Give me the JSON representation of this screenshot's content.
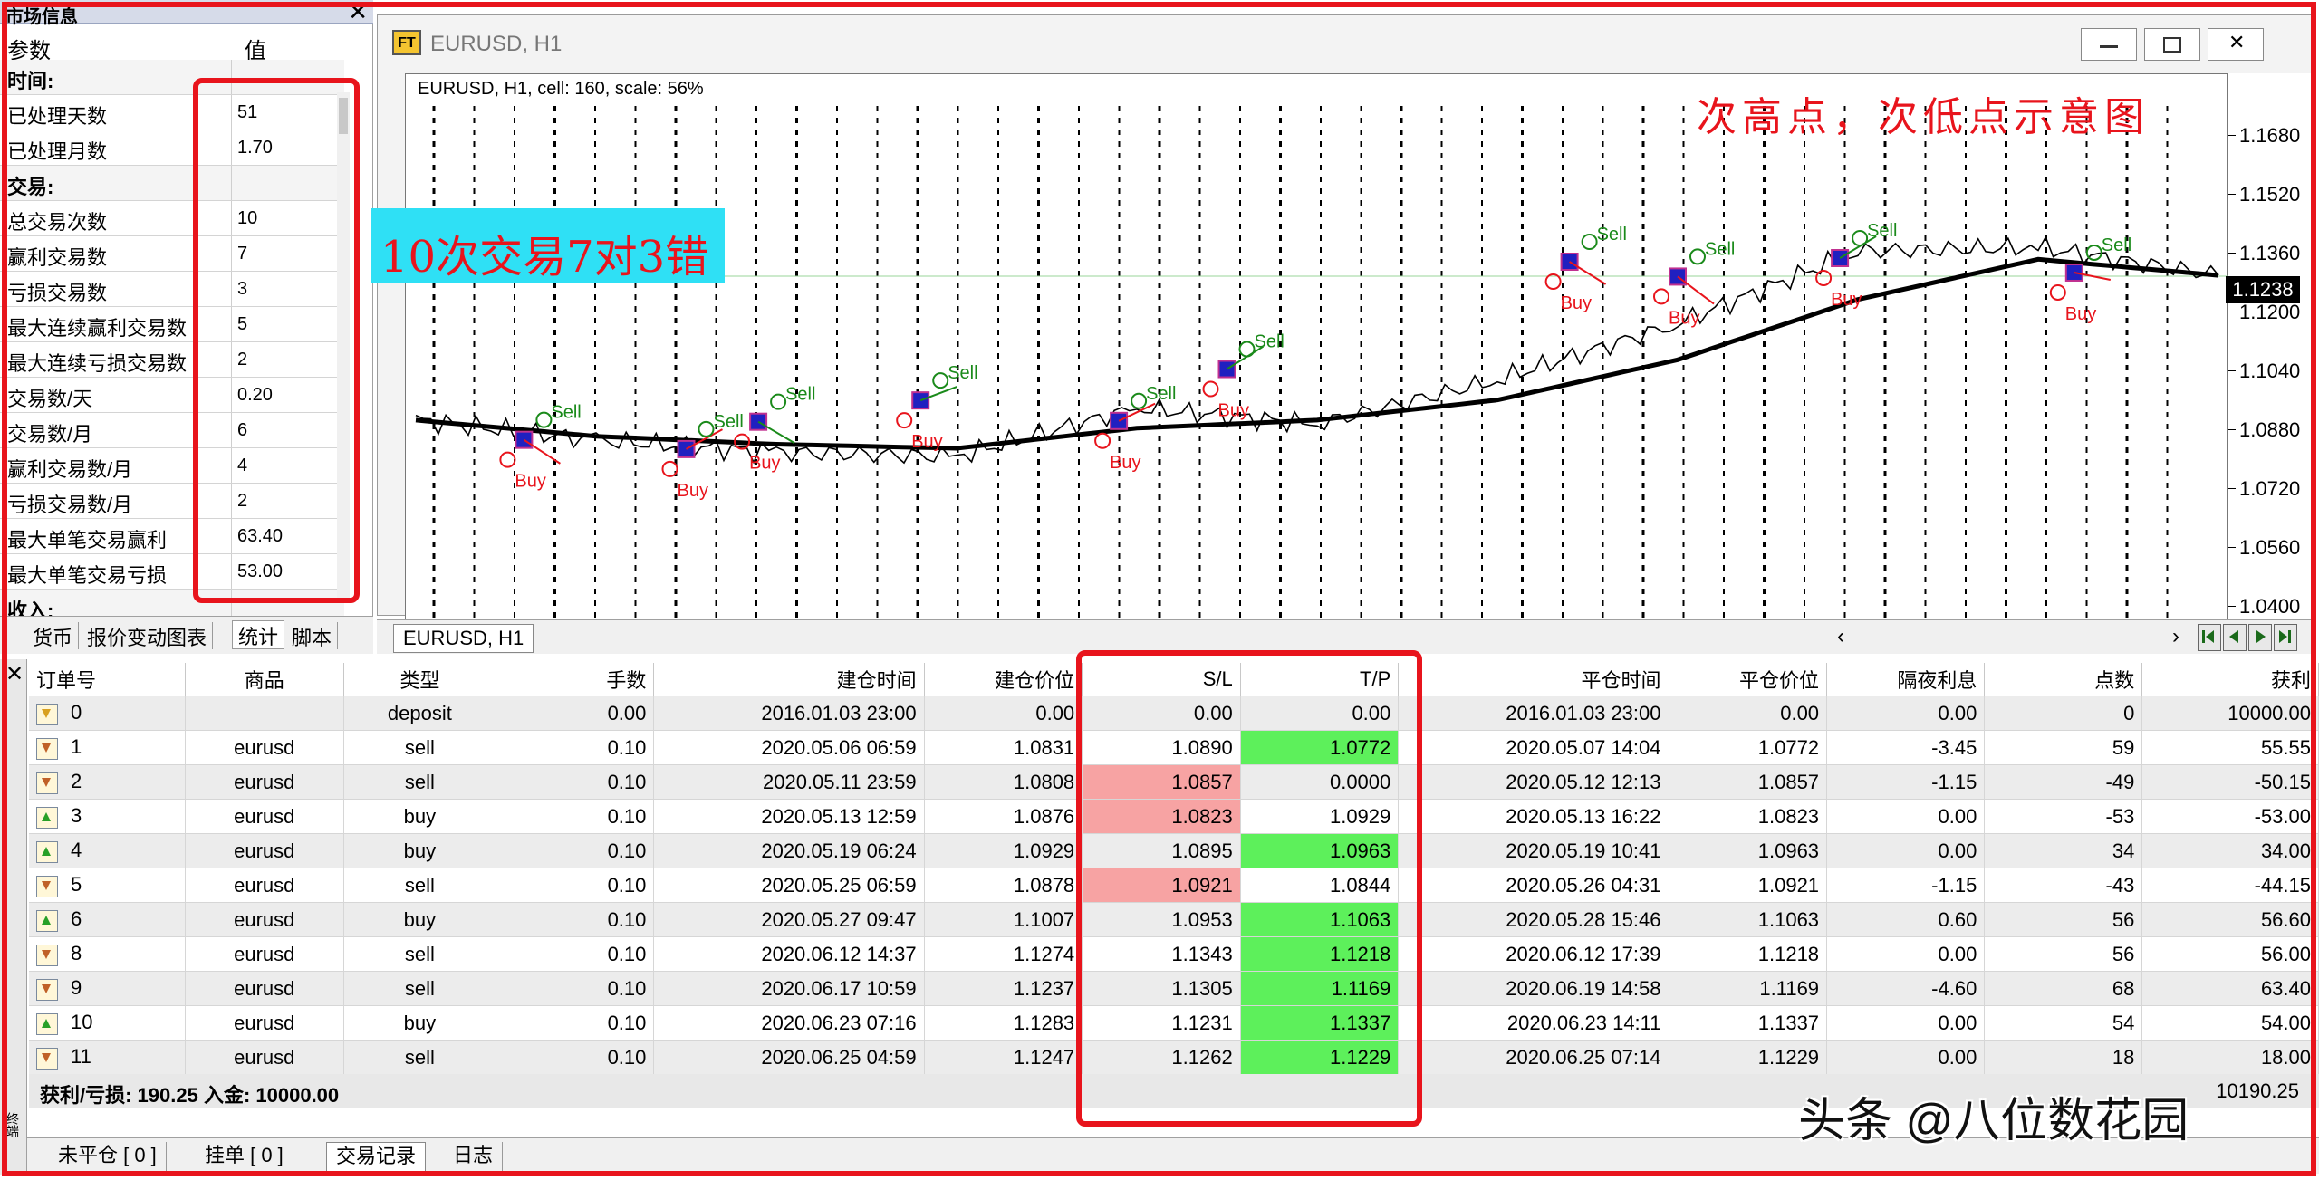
{
  "left_panel": {
    "title": "市场信息",
    "col_param": "参数",
    "col_value": "值",
    "rows": [
      {
        "k": "时间:",
        "v": "",
        "section": true
      },
      {
        "k": "已处理天数",
        "v": "51"
      },
      {
        "k": "已处理月数",
        "v": "1.70"
      },
      {
        "k": "交易:",
        "v": "",
        "section": true
      },
      {
        "k": "总交易次数",
        "v": "10"
      },
      {
        "k": "赢利交易数",
        "v": "7"
      },
      {
        "k": "亏损交易数",
        "v": "3"
      },
      {
        "k": "最大连续赢利交易数",
        "v": "5"
      },
      {
        "k": "最大连续亏损交易数",
        "v": "2"
      },
      {
        "k": "交易数/天",
        "v": "0.20"
      },
      {
        "k": "交易数/月",
        "v": "6"
      },
      {
        "k": "赢利交易数/月",
        "v": "4"
      },
      {
        "k": "亏损交易数/月",
        "v": "2"
      },
      {
        "k": "最大单笔交易赢利",
        "v": "63.40"
      },
      {
        "k": "最大单笔交易亏损",
        "v": "53.00"
      },
      {
        "k": "收入:",
        "v": "",
        "section": true
      }
    ],
    "tabs": [
      "货币",
      "报价变动图表",
      "统计",
      "脚本"
    ],
    "active_tab": 2
  },
  "annotation": "10次交易7对3错",
  "chart": {
    "window_title": "EURUSD, H1",
    "app_icon": "FT",
    "info": "EURUSD, H1, cell: 160, scale: 56%",
    "note": "次高点，次低点示意图",
    "price_ticks": [
      "1.1680",
      "1.1520",
      "1.1360",
      "1.1200",
      "1.1040",
      "1.0880",
      "1.0720",
      "1.0560",
      "1.0400"
    ],
    "current_price": "1.1238",
    "tab_label": "EURUSD, H1",
    "signal_buy": "Buy",
    "signal_sell": "Sell"
  },
  "chart_data": {
    "type": "line",
    "title": "",
    "xlabel": "",
    "ylabel": "",
    "ylim": [
      1.04,
      1.172
    ],
    "series": [
      {
        "name": "",
        "x": [
          0,
          10,
          20,
          30,
          40,
          50,
          60,
          70,
          80,
          90,
          100
        ],
        "values": [
          1.088,
          1.083,
          1.08,
          1.079,
          1.091,
          1.087,
          1.098,
          1.112,
          1.13,
          1.131,
          1.124
        ]
      },
      {
        "name": "",
        "x": [
          0,
          10,
          20,
          30,
          40,
          50,
          60,
          70,
          80,
          90,
          100
        ],
        "values": [
          1.088,
          1.084,
          1.082,
          1.081,
          1.086,
          1.088,
          1.093,
          1.103,
          1.118,
          1.128,
          1.124
        ]
      }
    ]
  },
  "trades": {
    "headers": [
      "订单号",
      "商品",
      "类型",
      "手数",
      "建仓时间",
      "建仓价位",
      "S/L",
      "T/P",
      "平仓时间",
      "平仓价位",
      "隔夜利息",
      "点数",
      "获利"
    ],
    "rows": [
      {
        "id": "0",
        "sym": "",
        "type": "deposit",
        "lots": "0.00",
        "open_time": "2016.01.03 23:00",
        "open_price": "0.00",
        "sl": "0.00",
        "tp": "0.00",
        "close_time": "2016.01.03 23:00",
        "close_price": "0.00",
        "swap": "0.00",
        "pips": "0",
        "profit": "10000.00",
        "icon": "dep",
        "sl_hl": "",
        "tp_hl": ""
      },
      {
        "id": "1",
        "sym": "eurusd",
        "type": "sell",
        "lots": "0.10",
        "open_time": "2020.05.06 06:59",
        "open_price": "1.0831",
        "sl": "1.0890",
        "tp": "1.0772",
        "close_time": "2020.05.07 14:04",
        "close_price": "1.0772",
        "swap": "-3.45",
        "pips": "59",
        "profit": "55.55",
        "icon": "sell",
        "sl_hl": "",
        "tp_hl": "green"
      },
      {
        "id": "2",
        "sym": "eurusd",
        "type": "sell",
        "lots": "0.10",
        "open_time": "2020.05.11 23:59",
        "open_price": "1.0808",
        "sl": "1.0857",
        "tp": "0.0000",
        "close_time": "2020.05.12 12:13",
        "close_price": "1.0857",
        "swap": "-1.15",
        "pips": "-49",
        "profit": "-50.15",
        "icon": "sell",
        "sl_hl": "pink",
        "tp_hl": ""
      },
      {
        "id": "3",
        "sym": "eurusd",
        "type": "buy",
        "lots": "0.10",
        "open_time": "2020.05.13 12:59",
        "open_price": "1.0876",
        "sl": "1.0823",
        "tp": "1.0929",
        "close_time": "2020.05.13 16:22",
        "close_price": "1.0823",
        "swap": "0.00",
        "pips": "-53",
        "profit": "-53.00",
        "icon": "buy",
        "sl_hl": "pink",
        "tp_hl": ""
      },
      {
        "id": "4",
        "sym": "eurusd",
        "type": "buy",
        "lots": "0.10",
        "open_time": "2020.05.19 06:24",
        "open_price": "1.0929",
        "sl": "1.0895",
        "tp": "1.0963",
        "close_time": "2020.05.19 10:41",
        "close_price": "1.0963",
        "swap": "0.00",
        "pips": "34",
        "profit": "34.00",
        "icon": "buy",
        "sl_hl": "",
        "tp_hl": "green"
      },
      {
        "id": "5",
        "sym": "eurusd",
        "type": "sell",
        "lots": "0.10",
        "open_time": "2020.05.25 06:59",
        "open_price": "1.0878",
        "sl": "1.0921",
        "tp": "1.0844",
        "close_time": "2020.05.26 04:31",
        "close_price": "1.0921",
        "swap": "-1.15",
        "pips": "-43",
        "profit": "-44.15",
        "icon": "sell",
        "sl_hl": "pink",
        "tp_hl": ""
      },
      {
        "id": "6",
        "sym": "eurusd",
        "type": "buy",
        "lots": "0.10",
        "open_time": "2020.05.27 09:47",
        "open_price": "1.1007",
        "sl": "1.0953",
        "tp": "1.1063",
        "close_time": "2020.05.28 15:46",
        "close_price": "1.1063",
        "swap": "0.60",
        "pips": "56",
        "profit": "56.60",
        "icon": "buy",
        "sl_hl": "",
        "tp_hl": "green"
      },
      {
        "id": "8",
        "sym": "eurusd",
        "type": "sell",
        "lots": "0.10",
        "open_time": "2020.06.12 14:37",
        "open_price": "1.1274",
        "sl": "1.1343",
        "tp": "1.1218",
        "close_time": "2020.06.12 17:39",
        "close_price": "1.1218",
        "swap": "0.00",
        "pips": "56",
        "profit": "56.00",
        "icon": "sell",
        "sl_hl": "",
        "tp_hl": "green"
      },
      {
        "id": "9",
        "sym": "eurusd",
        "type": "sell",
        "lots": "0.10",
        "open_time": "2020.06.17 10:59",
        "open_price": "1.1237",
        "sl": "1.1305",
        "tp": "1.1169",
        "close_time": "2020.06.19 14:58",
        "close_price": "1.1169",
        "swap": "-4.60",
        "pips": "68",
        "profit": "63.40",
        "icon": "sell",
        "sl_hl": "",
        "tp_hl": "green"
      },
      {
        "id": "10",
        "sym": "eurusd",
        "type": "buy",
        "lots": "0.10",
        "open_time": "2020.06.23 07:16",
        "open_price": "1.1283",
        "sl": "1.1231",
        "tp": "1.1337",
        "close_time": "2020.06.23 14:11",
        "close_price": "1.1337",
        "swap": "0.00",
        "pips": "54",
        "profit": "54.00",
        "icon": "buy",
        "sl_hl": "",
        "tp_hl": "green"
      },
      {
        "id": "11",
        "sym": "eurusd",
        "type": "sell",
        "lots": "0.10",
        "open_time": "2020.06.25 04:59",
        "open_price": "1.1247",
        "sl": "1.1262",
        "tp": "1.1229",
        "close_time": "2020.06.25 07:14",
        "close_price": "1.1229",
        "swap": "0.00",
        "pips": "18",
        "profit": "18.00",
        "icon": "sell",
        "sl_hl": "",
        "tp_hl": "green"
      }
    ],
    "totals_label": "获利/亏损: 190.25  入金: 10000.00",
    "totals_sum": "10190.25"
  },
  "terminal_tabs": [
    "未平仓 [ 0 ]",
    "挂单 [ 0 ]",
    "交易记录",
    "日志"
  ],
  "terminal_active_tab": 2,
  "terminal_side_label": "终端",
  "watermark": "头条 @八位数花园",
  "colors": {
    "frame": "#e8141c",
    "annotation_bg": "#2fe0f5",
    "tp_hit": "#5df05b",
    "sl_hit": "#f7a3a3",
    "buy_marker": "#e8141c",
    "sell_marker": "#1a8a1a",
    "order_marker": "#2020c0"
  }
}
